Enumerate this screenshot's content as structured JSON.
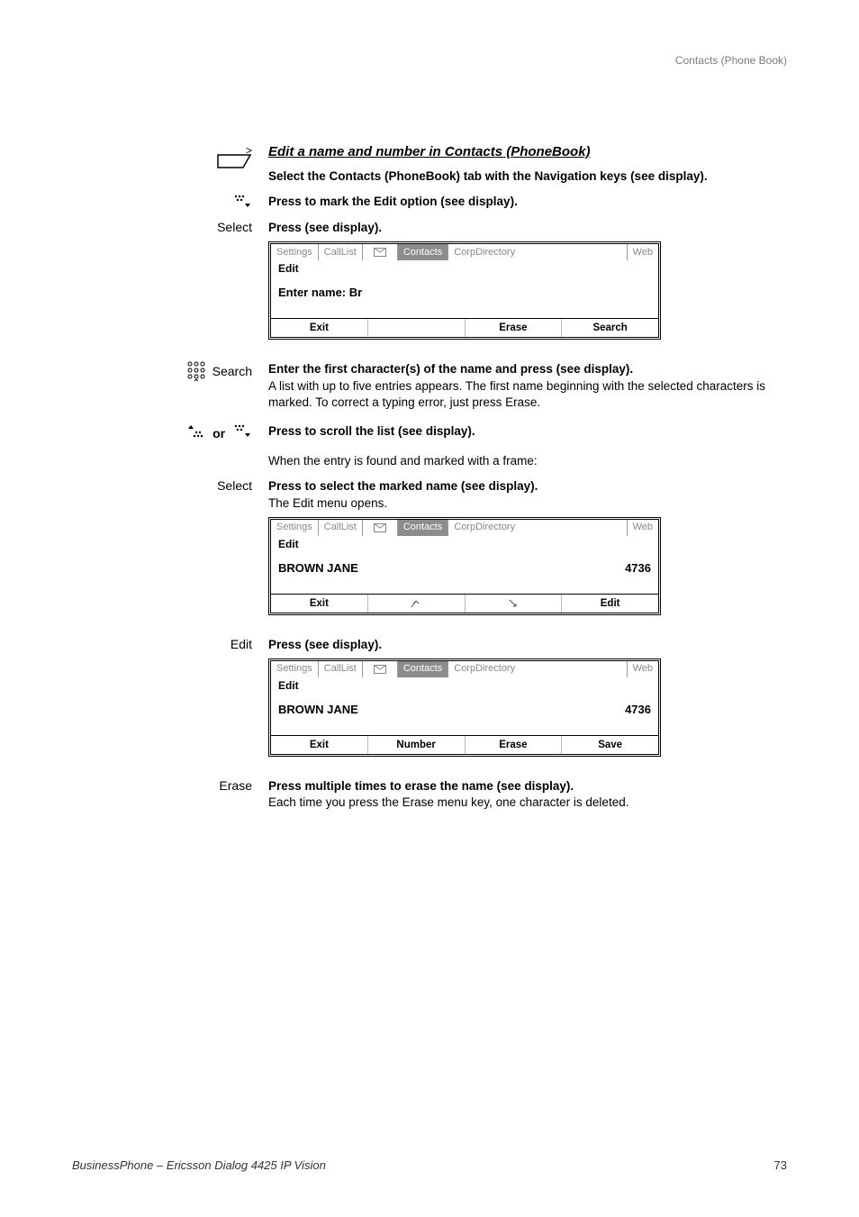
{
  "running_head": "Contacts (Phone Book)",
  "section_title": "Edit a name and number in Contacts (PhoneBook)",
  "step1": {
    "left_mark": ">",
    "text": "Select the Contacts (PhoneBook) tab with the Navigation keys (see display)."
  },
  "step2": {
    "text": "Press to mark the Edit option (see display)."
  },
  "step3": {
    "left_label": "Select",
    "text": "Press (see display)."
  },
  "display_a": {
    "tabs": {
      "settings": "Settings",
      "calllist": "CallList",
      "contacts": "Contacts",
      "corp": "CorpDirectory",
      "web": "Web"
    },
    "mode": "Edit",
    "main": "Enter name: Br",
    "softkeys": [
      "Exit",
      "",
      "Erase",
      "Search"
    ]
  },
  "step4": {
    "left_label": "Search",
    "bold": "Enter the first character(s) of the name and press (see display).",
    "body": "A list with up to five entries appears. The first name beginning with the selected characters is marked. To correct a typing error, just press Erase."
  },
  "step5": {
    "left_sep": "or",
    "text": "Press to scroll the list (see display)."
  },
  "step5b": {
    "text": "When the entry is found and marked with a frame:"
  },
  "step6": {
    "left_label": "Select",
    "bold": "Press to select the marked name (see display).",
    "body": "The Edit menu opens."
  },
  "display_b": {
    "tabs": {
      "settings": "Settings",
      "calllist": "CallList",
      "contacts": "Contacts",
      "corp": "CorpDirectory",
      "web": "Web"
    },
    "mode": "Edit",
    "name": "BROWN JANE",
    "number": "4736",
    "softkeys": [
      "Exit",
      "↖",
      "↘",
      "Edit"
    ]
  },
  "step7": {
    "left_label": "Edit",
    "text": "Press (see display)."
  },
  "display_c": {
    "tabs": {
      "settings": "Settings",
      "calllist": "CallList",
      "contacts": "Contacts",
      "corp": "CorpDirectory",
      "web": "Web"
    },
    "mode": "Edit",
    "name": "BROWN JANE",
    "number": "4736",
    "softkeys": [
      "Exit",
      "Number",
      "Erase",
      "Save"
    ]
  },
  "step8": {
    "left_label": "Erase",
    "bold": "Press multiple times to erase the name (see display).",
    "body": "Each time you press the Erase menu key, one character is deleted."
  },
  "footer": {
    "left": "BusinessPhone – Ericsson Dialog 4425 IP Vision",
    "page": "73"
  }
}
